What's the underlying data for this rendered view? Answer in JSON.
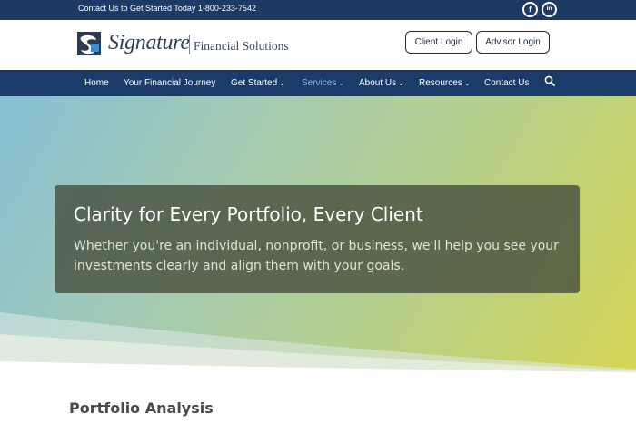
{
  "topbar": {
    "contact_text": "Contact Us to Get Started Today 1-800-233-7542",
    "social": [
      {
        "icon": "facebook-icon",
        "glyph": "f"
      },
      {
        "icon": "linkedin-icon",
        "glyph": "in"
      }
    ]
  },
  "header": {
    "brand_name": "Signature",
    "brand_tagline": "Financial Solutions",
    "client_login": "Client Login",
    "advisor_login": "Advisor Login"
  },
  "nav": {
    "items": [
      {
        "label": "Home"
      },
      {
        "label": "Your Financial Journey"
      },
      {
        "label": "Get Started"
      },
      {
        "label": "Services"
      },
      {
        "label": "About Us"
      },
      {
        "label": "Resources"
      },
      {
        "label": "Contact Us"
      }
    ],
    "search_icon": "search-icon"
  },
  "hero": {
    "title": "Clarity for Every Portfolio, Every Client",
    "subtitle": "Whether you're an individual, nonprofit, or business, we'll help you see your investments clearly and align them with your goals."
  },
  "section": {
    "title": "Portfolio Analysis"
  },
  "colors": {
    "topbar": "#1e3a64",
    "nav": "#1b3b6a",
    "nav_active": "#8fb2e6"
  }
}
